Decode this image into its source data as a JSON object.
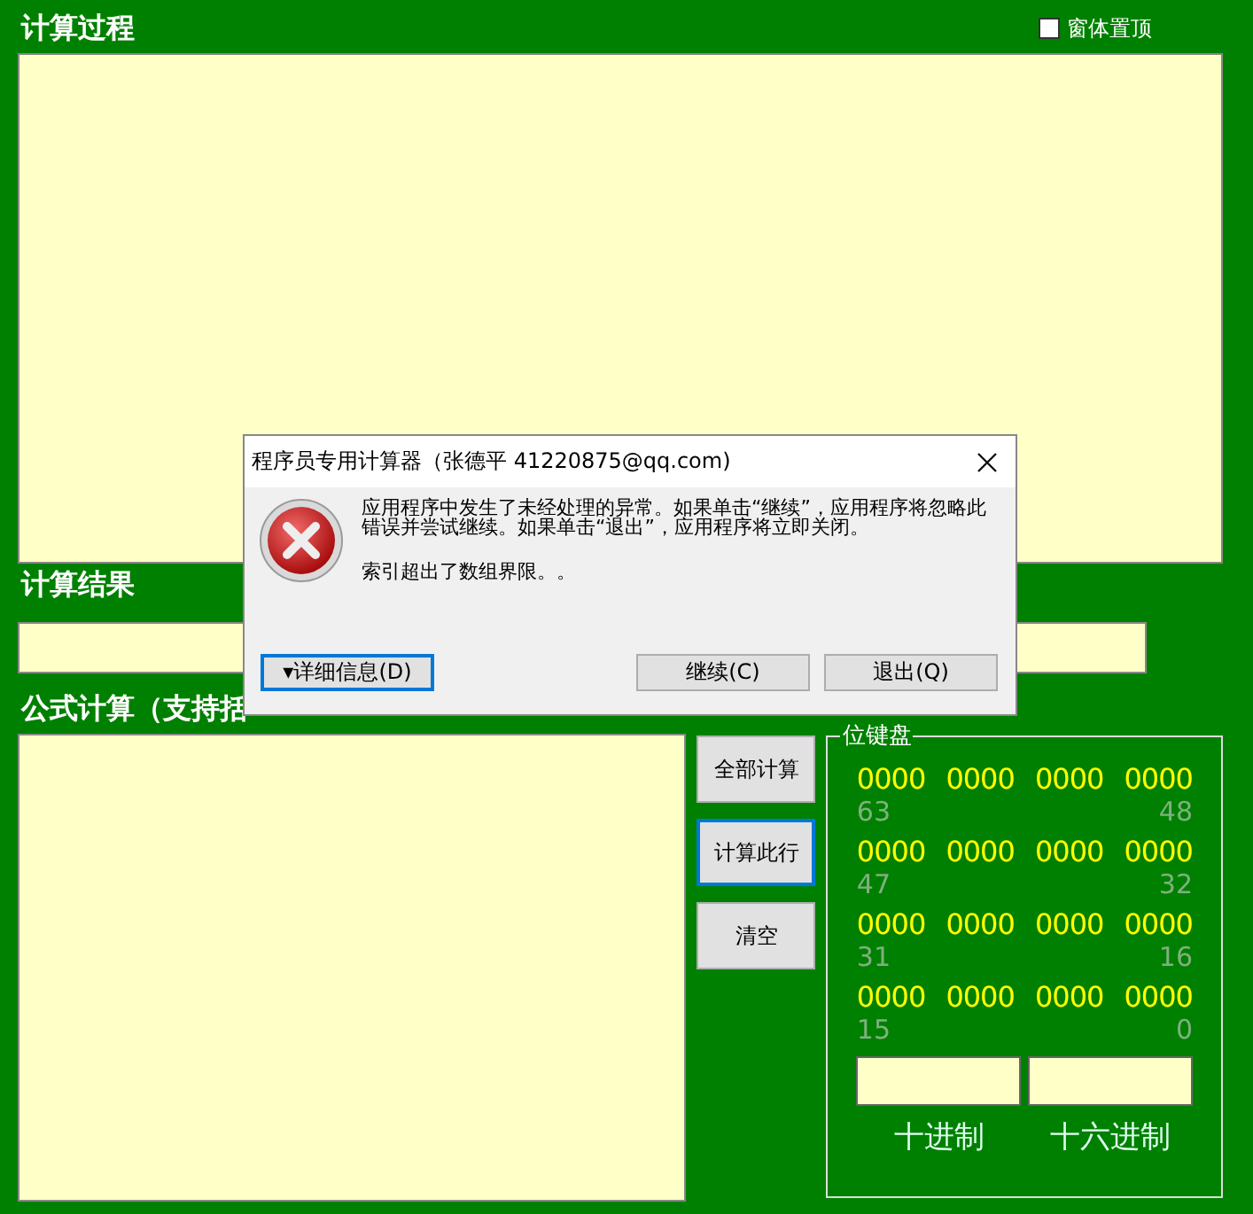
{
  "process": {
    "title": "计算过程",
    "pin_option": {
      "label": "窗体置顶",
      "checked": false
    }
  },
  "result": {
    "title": "计算结果"
  },
  "formula": {
    "title": "公式计算（支持括"
  },
  "actions": [
    {
      "label": "全部计算",
      "focused": false
    },
    {
      "label": "计算此行",
      "focused": true
    },
    {
      "label": "清空",
      "focused": false
    }
  ],
  "bit_keyboard": {
    "title": "位键盘",
    "rows": [
      {
        "groups": [
          "0000",
          "0000",
          "0000",
          "0000"
        ],
        "high": "63",
        "low": "48"
      },
      {
        "groups": [
          "0000",
          "0000",
          "0000",
          "0000"
        ],
        "high": "47",
        "low": "32"
      },
      {
        "groups": [
          "0000",
          "0000",
          "0000",
          "0000"
        ],
        "high": "31",
        "low": "16"
      },
      {
        "groups": [
          "0000",
          "0000",
          "0000",
          "0000"
        ],
        "high": "15",
        "low": "0"
      }
    ],
    "fields": [
      {
        "label": "十进制"
      },
      {
        "label": "十六进制"
      }
    ]
  },
  "dialog": {
    "title": "程序员专用计算器（张德平 41220875@qq.com)",
    "message": "应用程序中发生了未经处理的异常。如果单击“继续”，应用程序将忽略此错误并尝试继续。如果单击“退出”，应用程序将立即关闭。",
    "detail": "索引超出了数组界限。。",
    "buttons": [
      {
        "label": "▾详细信息(D)",
        "focused": true
      },
      {
        "label": "继续(C)",
        "focused": false
      },
      {
        "label": "退出(Q)",
        "focused": false
      }
    ]
  }
}
